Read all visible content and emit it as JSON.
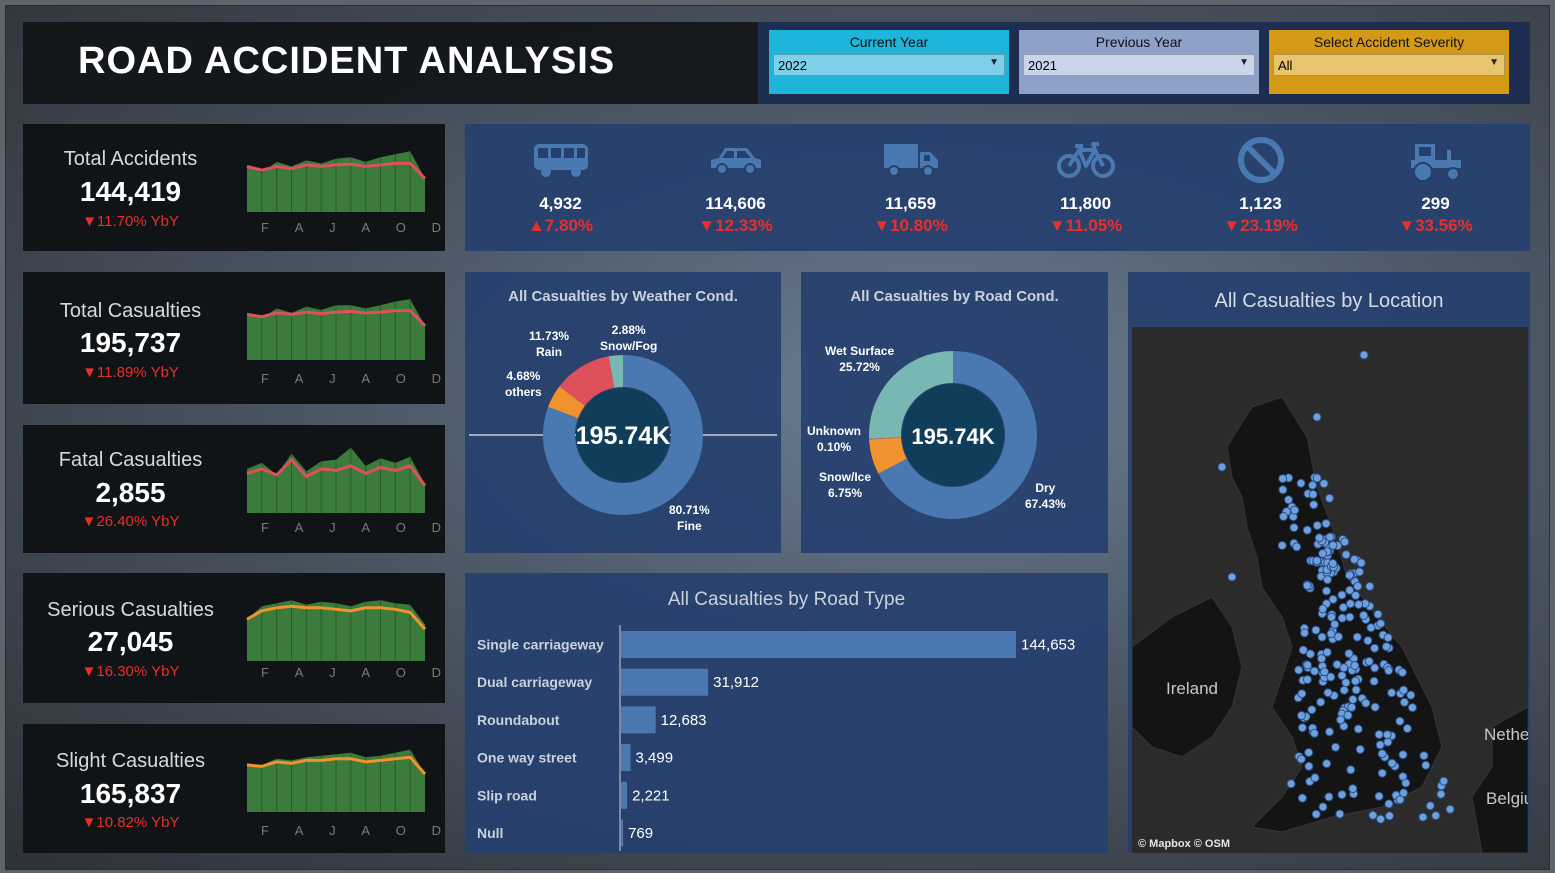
{
  "header": {
    "title": "ROAD ACCIDENT ANALYSIS"
  },
  "filters": [
    {
      "label": "Current Year",
      "value": "2022",
      "color": "#1fb4d9",
      "field": "#7ed0ea"
    },
    {
      "label": "Previous Year",
      "value": "2021",
      "color": "#8fa1c9",
      "field": "#c9d3ea"
    },
    {
      "label": "Select Accident Severity",
      "value": "All",
      "color": "#d49a17",
      "field": "#e8c46c"
    }
  ],
  "months": [
    "F",
    "A",
    "J",
    "A",
    "O",
    "D"
  ],
  "kpis": [
    {
      "title": "Total Accidents",
      "value": "144,419",
      "change": "▼11.70% YbY",
      "line_color": "#e0505a",
      "area": [
        0.62,
        0.52,
        0.66,
        0.6,
        0.68,
        0.64,
        0.7,
        0.72,
        0.66,
        0.72,
        0.76,
        0.8,
        0.44
      ],
      "line": [
        0.6,
        0.55,
        0.6,
        0.57,
        0.62,
        0.6,
        0.62,
        0.63,
        0.6,
        0.62,
        0.64,
        0.64,
        0.44
      ]
    },
    {
      "title": "Total Casualties",
      "value": "195,737",
      "change": "▼11.89% YbY",
      "line_color": "#e0505a",
      "area": [
        0.6,
        0.55,
        0.68,
        0.62,
        0.7,
        0.66,
        0.72,
        0.72,
        0.68,
        0.72,
        0.77,
        0.8,
        0.45
      ],
      "line": [
        0.6,
        0.57,
        0.62,
        0.6,
        0.63,
        0.61,
        0.63,
        0.64,
        0.62,
        0.63,
        0.65,
        0.65,
        0.45
      ]
    },
    {
      "title": "Fatal Casualties",
      "value": "2,855",
      "change": "▼26.40% YbY",
      "line_color": "#e0505a",
      "area": [
        0.58,
        0.66,
        0.5,
        0.78,
        0.55,
        0.68,
        0.7,
        0.86,
        0.62,
        0.72,
        0.66,
        0.74,
        0.38
      ],
      "line": [
        0.52,
        0.58,
        0.5,
        0.7,
        0.48,
        0.58,
        0.56,
        0.62,
        0.52,
        0.6,
        0.56,
        0.62,
        0.36
      ]
    },
    {
      "title": "Serious Casualties",
      "value": "27,045",
      "change": "▼16.30% YbY",
      "line_color": "#f0922d",
      "area": [
        0.55,
        0.72,
        0.76,
        0.8,
        0.74,
        0.78,
        0.76,
        0.72,
        0.78,
        0.8,
        0.76,
        0.74,
        0.48
      ],
      "line": [
        0.55,
        0.66,
        0.7,
        0.72,
        0.7,
        0.7,
        0.68,
        0.66,
        0.7,
        0.7,
        0.68,
        0.64,
        0.42
      ]
    },
    {
      "title": "Slight Casualties",
      "value": "165,837",
      "change": "▼10.82% YbY",
      "line_color": "#f0922d",
      "area": [
        0.6,
        0.62,
        0.7,
        0.68,
        0.72,
        0.74,
        0.76,
        0.78,
        0.72,
        0.74,
        0.78,
        0.82,
        0.5
      ],
      "line": [
        0.62,
        0.6,
        0.66,
        0.64,
        0.68,
        0.68,
        0.7,
        0.7,
        0.66,
        0.68,
        0.7,
        0.72,
        0.5
      ]
    }
  ],
  "vehicles": [
    {
      "icon": "bus-icon",
      "value": "4,932",
      "change": "▲7.80%"
    },
    {
      "icon": "car-icon",
      "value": "114,606",
      "change": "▼12.33%"
    },
    {
      "icon": "truck-icon",
      "value": "11,659",
      "change": "▼10.80%"
    },
    {
      "icon": "bicycle-icon",
      "value": "11,800",
      "change": "▼11.05%"
    },
    {
      "icon": "no-entry-icon",
      "value": "1,123",
      "change": "▼23.19%"
    },
    {
      "icon": "tractor-icon",
      "value": "299",
      "change": "▼33.56%"
    }
  ],
  "colors": {
    "accent_blue": "#4a79b1",
    "dark_center": "#0f3d5a",
    "red": "#e0505a",
    "orange": "#f0922d",
    "teal": "#79b8b2",
    "spark_green": "#3b7b3b"
  },
  "chart_data": [
    {
      "type": "pie",
      "title": "All Casualties by Weather Cond.",
      "center_label": "195.74K",
      "slices": [
        {
          "label": "Fine",
          "value": 80.71,
          "text": "80.71%",
          "color": "#4a79b1"
        },
        {
          "label": "others",
          "value": 4.68,
          "text": "4.68%",
          "color": "#f0922d"
        },
        {
          "label": "Rain",
          "value": 11.73,
          "text": "11.73%",
          "color": "#e0505a"
        },
        {
          "label": "Snow/Fog",
          "value": 2.88,
          "text": "2.88%",
          "color": "#79b8b2"
        }
      ]
    },
    {
      "type": "pie",
      "title": "All Casualties by Road Cond.",
      "center_label": "195.74K",
      "slices": [
        {
          "label": "Dry",
          "value": 67.43,
          "text": "67.43%",
          "color": "#4a79b1"
        },
        {
          "label": "Snow/Ice",
          "value": 6.75,
          "text": "6.75%",
          "color": "#f0922d"
        },
        {
          "label": "Unknown",
          "value": 0.1,
          "text": "0.10%",
          "color": "#e0505a"
        },
        {
          "label": "Wet Surface",
          "value": 25.72,
          "text": "25.72%",
          "color": "#79b8b2"
        }
      ]
    },
    {
      "type": "bar",
      "orientation": "horizontal",
      "title": "All Casualties by Road Type",
      "categories": [
        "Single carriageway",
        "Dual carriageway",
        "Roundabout",
        "One way street",
        "Slip road",
        "Null"
      ],
      "values": [
        144653,
        31912,
        12683,
        3499,
        2221,
        769
      ],
      "value_labels": [
        "144,653",
        "31,912",
        "12,683",
        "3,499",
        "2,221",
        "769"
      ]
    }
  ],
  "map": {
    "title": "All Casualties by Location",
    "labels": {
      "ireland": "Ireland",
      "netherlands": "Nethe",
      "belgium": "Belgiu"
    },
    "attribution": "© Mapbox  © OSM"
  }
}
